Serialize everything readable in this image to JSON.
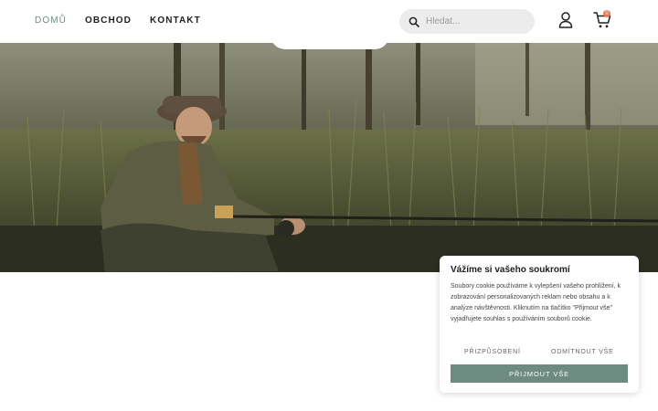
{
  "nav": {
    "items": [
      {
        "label": "DOMŮ",
        "active": true
      },
      {
        "label": "OBCHOD",
        "active": false
      },
      {
        "label": "KONTAKT",
        "active": false
      }
    ]
  },
  "search": {
    "placeholder": "Hledat..."
  },
  "cart": {
    "count": "0"
  },
  "hero": {
    "image": "man fishing with rod among tall reeds"
  },
  "cookie": {
    "title": "Vážíme si vašeho soukromí",
    "text": "Soubory cookie používáme k vylepšení vašeho prohlížení, k zobrazování personalizovaných reklam nebo obsahu a k analýze návštěvnosti. Kliknutím na tlačítko \"Přijmout vše\" vyjadřujete souhlas s používáním souborů cookie.",
    "customize_label": "PŘIZPŮSOBENÍ",
    "reject_label": "ODMÍTNOUT VŠE",
    "accept_label": "PŘIJMOUT VŠE"
  },
  "colors": {
    "accent": "#6f8c82",
    "badge": "#e07b52"
  }
}
